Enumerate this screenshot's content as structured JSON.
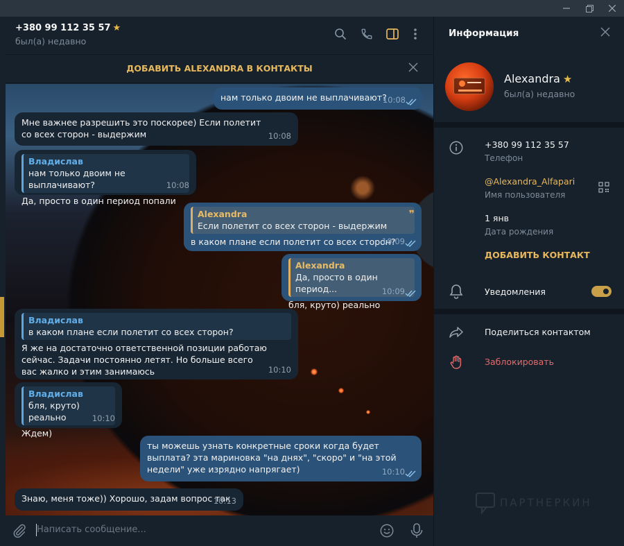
{
  "window": {
    "buttons": [
      "minimize",
      "restore",
      "close"
    ]
  },
  "header": {
    "title": "+380 99 112 35 57",
    "status": "был(а) недавно",
    "icons": [
      "search-icon",
      "phone-icon",
      "sidebar-icon",
      "more-icon"
    ]
  },
  "add_bar": {
    "label": "ДОБАВИТЬ ALEXANDRA В КОНТАКТЫ"
  },
  "messages": [
    {
      "dir": "out",
      "text": "нам только двоим не выплачивают?",
      "time": "10:08",
      "read": true
    },
    {
      "dir": "in",
      "text": "Мне важнее разрешить это поскорее) Если полетит со всех сторон - выдержим",
      "time": "10:08"
    },
    {
      "dir": "in",
      "quote_name": "Владислав",
      "quote_text": "нам только двоим не выплачивают?",
      "text": "Да, просто в один период попали",
      "time": "10:08"
    },
    {
      "dir": "out",
      "quote_name": "Alexandra",
      "quote_text": "Если полетит со всех сторон - выдержим",
      "text": "в каком плане если полетит со всех сторон?",
      "time": "10:09",
      "read": true
    },
    {
      "dir": "out",
      "quote_name": "Alexandra",
      "quote_text": "Да, просто в один период...",
      "text": "бля, круто) реально",
      "time": "10:09",
      "read": true
    },
    {
      "dir": "in",
      "quote_name": "Владислав",
      "quote_text": "в каком плане если полетит со всех сторон?",
      "text": "Я же на достаточно ответственной позиции работаю сейчас. Задачи постоянно летят. Но больше всего вас жалко и этим занимаюсь",
      "time": "10:10"
    },
    {
      "dir": "in",
      "quote_name": "Владислав",
      "quote_text": "бля, круто) реально",
      "text": "Ждем)",
      "time": "10:10"
    },
    {
      "dir": "out",
      "text": "ты можешь узнать конкретные сроки когда будет выплата? эта мариновка \"на днях\", \"скоро\" и \"на этой недели\" уже изрядно напрягает)",
      "time": "10:10",
      "read": true
    },
    {
      "dir": "in",
      "text": "Знаю, меня тоже)) Хорошо, задам вопрос так",
      "time": "10:13"
    }
  ],
  "composer": {
    "placeholder": "Написать сообщение..."
  },
  "info": {
    "title": "Информация",
    "name": "Alexandra",
    "status": "был(а) недавно",
    "phone": "+380 99 112 35 57",
    "phone_label": "Телефон",
    "username": "@Alexandra_Alfapari",
    "username_label": "Имя пользователя",
    "birthday": "1 янв",
    "birthday_label": "Дата рождения",
    "add_contact": "ДОБАВИТЬ КОНТАКТ",
    "notifications": "Уведомления",
    "notifications_on": true,
    "share": "Поделиться контактом",
    "block": "Заблокировать"
  },
  "watermark": "ПАРТНЕРКИН",
  "colors": {
    "accent": "#e8b85c",
    "danger": "#e16c6c",
    "bubble_in": "#182533",
    "bubble_out": "#2b5278"
  }
}
